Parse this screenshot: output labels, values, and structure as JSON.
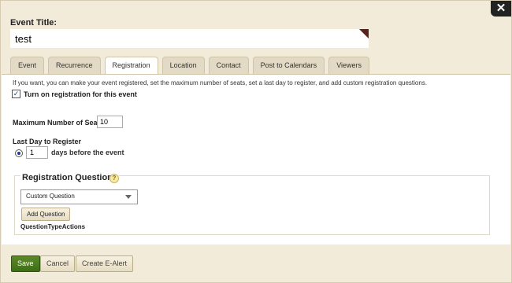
{
  "dialog": {
    "close_label": "✕"
  },
  "event_title": {
    "label": "Event Title:",
    "value": "test"
  },
  "tabs": [
    {
      "label": "Event",
      "active": false
    },
    {
      "label": "Recurrence",
      "active": false
    },
    {
      "label": "Registration",
      "active": true
    },
    {
      "label": "Location",
      "active": false
    },
    {
      "label": "Contact",
      "active": false
    },
    {
      "label": "Post to Calendars",
      "active": false
    },
    {
      "label": "Viewers",
      "active": false
    }
  ],
  "registration": {
    "info_text": "If you want, you can make your event registered, set the maximum number of seats, set a last day to register, and add custom registration questions.",
    "turn_on_label": "Turn on registration for this event",
    "turn_on_checked": true,
    "max_seats_label": "Maximum Number of Seats",
    "max_seats_value": "10",
    "last_day_label": "Last Day to Register",
    "days_value": "1",
    "days_suffix": "days before the event",
    "questions": {
      "title": "Registration Questions",
      "help_label": "?",
      "select_value": "Custom Question",
      "add_button": "Add Question",
      "actions_label": "QuestionTypeActions"
    }
  },
  "footer": {
    "save": "Save",
    "cancel": "Cancel",
    "create_ealert": "Create E-Alert"
  },
  "colors": {
    "dialog_bg": "#f2ebd9",
    "save_green": "#4a7a1f",
    "close_bg": "#222222"
  }
}
